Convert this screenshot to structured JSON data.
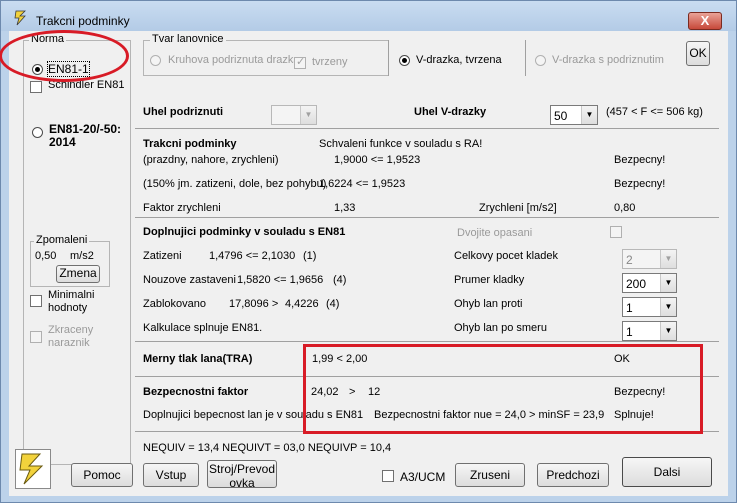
{
  "window": {
    "title": "Trakcni podminky",
    "close_glyph": "X"
  },
  "norma": {
    "title": "Norma",
    "option1": "EN81-1",
    "option1_hidden_check": "Schindler EN81",
    "option2_line1": "EN81-20/-50:",
    "option2_line2": "2014",
    "zpomaleni_title": "Zpomaleni",
    "zpomaleni_value": "0,50",
    "zpomaleni_unit": "m/s2",
    "zmena_button": "Zmena",
    "minimalni_line1": "Minimalni",
    "minimalni_line2": "hodnoty",
    "zkraceny_line1": "Zkraceny",
    "zkraceny_line2": "naraznik"
  },
  "tvar": {
    "title": "Tvar lanovnice",
    "kruhova": "Kruhova podriznuta drazka",
    "tvrzeny": "tvrzeny",
    "vdrazka_tvrzena": "V-drazka, tvrzena",
    "vdrazka_podriznutim": "V-drazka s podriznutim",
    "ok_button": "OK"
  },
  "uhel": {
    "uhel_podriznuti_label": "Uhel podriznuti",
    "uhel_podriznuti_value": "",
    "uhel_vdrazky_label": "Uhel V-drazky",
    "uhel_vdrazky_value": "50",
    "range_note": "(457 < F <= 506 kg)"
  },
  "trakcni": {
    "heading": "Trakcni podminky",
    "status_text": "Schvaleni funkce v souladu s RA!",
    "row1_label": "(prazdny, nahore, zrychleni)",
    "row1_value": "1,9000 <= 1,9523",
    "row1_result": "Bezpecny!",
    "row2_label": "(150% jm. zatizeni, dole, bez pohybu)",
    "row2_value": "1,6224 <= 1,9523",
    "row2_result": "Bezpecny!",
    "faktor_label": "Faktor zrychleni",
    "faktor_value": "1,33",
    "zrychleni_label": "Zrychleni [m/s2]",
    "zrychleni_value": "0,80"
  },
  "doplnujici": {
    "heading": "Doplnujici podminky v souladu s EN81",
    "dvojite_label": "Dvojite opasani",
    "zatizeni_label": "Zatizeni",
    "zatizeni_value": "1,4796 <= 2,1030",
    "zatizeni_ref": "(1)",
    "nouzove_label": "Nouzove zastaveni",
    "nouzove_value": "1,5820 <= 1,9656",
    "nouzove_ref": "(4)",
    "zablokovano_label": "Zablokovano",
    "zablokovano_value": "17,8096 >",
    "zablokovano_value2": "4,4226",
    "zablokovano_ref": "(4)",
    "kalkulace_text": "Kalkulace splnuje EN81.",
    "celkovy_label": "Celkovy pocet kladek",
    "celkovy_value": "2",
    "prumer_label": "Prumer kladky",
    "prumer_value": "200",
    "ohyb_proti_label": "Ohyb lan proti",
    "ohyb_proti_value": "1",
    "ohyb_smeru_label": "Ohyb lan  po smeru",
    "ohyb_smeru_value": "1"
  },
  "merny": {
    "label": "Merny tlak lana(TRA)",
    "value": "1,99 < 2,00",
    "result": "OK"
  },
  "bezpecnostni": {
    "label": "Bezpecnostni faktor",
    "value": "24,02",
    "operator": ">",
    "threshold": "12",
    "result": "Bezpecny!",
    "doplnujici_text": "Doplnujici bepecnost lan je v souladu s EN81",
    "faktor_text": "Bezpecnostni faktor nue = 24,0 > minSF = 23,9",
    "splnuje": "Splnuje!"
  },
  "nequiv_text": "NEQUIV = 13,4  NEQUIVT = 03,0  NEQUIVP = 10,4",
  "footer": {
    "pomoc": "Pomoc",
    "vstup": "Vstup",
    "stroj_line1": "Stroj/Prevod",
    "stroj_line2": "ovka",
    "a3ucm": "A3/UCM",
    "zruseni": "Zruseni",
    "predchozi": "Predchozi",
    "dalsi": "Dalsi"
  },
  "colors": {
    "annotation_red": "#d81b26",
    "title_bar": "#bcd2ea",
    "logo_yellow": "#f2d23c"
  }
}
